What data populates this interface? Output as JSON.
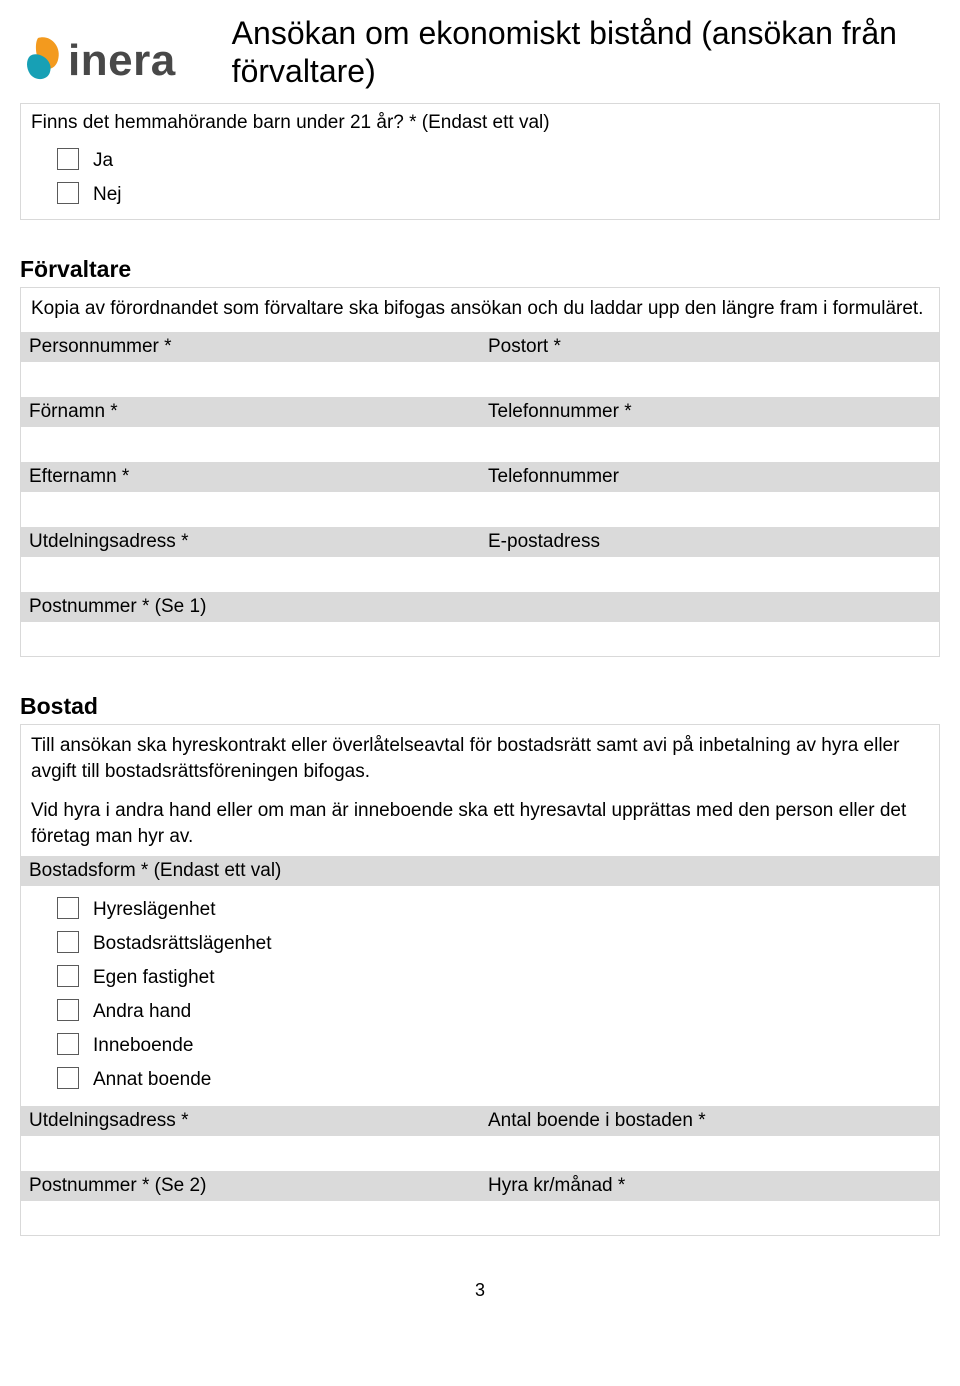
{
  "header": {
    "logo_text": "inera",
    "title": "Ansökan om ekonomiskt bistånd (ansökan från förvaltare)"
  },
  "s1": {
    "question": "Finns det hemmahörande barn under 21 år? * (Endast ett val)",
    "opts": [
      "Ja",
      "Nej"
    ]
  },
  "s2": {
    "title": "Förvaltare",
    "intro": "Kopia av förordnandet som förvaltare ska bifogas ansökan och du laddar upp den längre fram i formuläret.",
    "fields": {
      "l0": "Personnummer *",
      "r0": "Postort *",
      "l1": "Förnamn *",
      "r1": "Telefonnummer *",
      "l2": "Efternamn *",
      "r2": "Telefonnummer",
      "l3": "Utdelningsadress *",
      "r3": "E-postadress",
      "l4": "Postnummer * (Se 1)",
      "r4": ""
    }
  },
  "s3": {
    "title": "Bostad",
    "p1": "Till ansökan ska hyreskontrakt eller överlåtelseavtal för bostadsrätt samt avi på inbetalning av hyra eller avgift till bostadsrättsföreningen bifogas.",
    "p2": "Vid hyra i andra hand eller om man är inneboende ska ett hyresavtal upprättas med den person eller det företag man hyr av.",
    "bostadsform_label": "Bostadsform * (Endast ett val)",
    "opts": [
      "Hyreslägenhet",
      "Bostadsrättslägenhet",
      "Egen fastighet",
      "Andra hand",
      "Inneboende",
      "Annat boende"
    ],
    "fields": {
      "l0": "Utdelningsadress *",
      "r0": "Antal boende i bostaden *",
      "l1": "Postnummer * (Se 2)",
      "r1": "Hyra kr/månad *"
    }
  },
  "page_num": "3"
}
